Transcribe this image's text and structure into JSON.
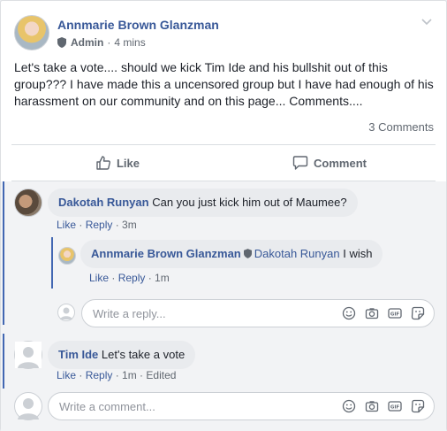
{
  "post": {
    "author": "Annmarie Brown Glanzman",
    "role": "Admin",
    "separator": "·",
    "time": "4 mins",
    "text": "Let's take a vote.... should we kick Tim Ide and his bullshit out of this group??? I have made this a uncensored group but I have had enough of his harassment on our community and on this page... Comments....",
    "comment_count": "3 Comments"
  },
  "actions": {
    "like": "Like",
    "comment": "Comment"
  },
  "comments": [
    {
      "author": "Dakotah Runyan",
      "text": "Can you just kick him out of Maumee?",
      "like": "Like",
      "reply": "Reply",
      "time": "3m",
      "replies": [
        {
          "author": "Annmarie Brown Glanzman",
          "mention": "Dakotah Runyan",
          "text": "I wish",
          "like": "Like",
          "reply": "Reply",
          "time": "1m"
        }
      ],
      "reply_placeholder": "Write a reply..."
    },
    {
      "author": "Tim Ide",
      "text": "Let's take a vote",
      "like": "Like",
      "reply": "Reply",
      "time": "1m",
      "edited": "Edited"
    }
  ],
  "composer": {
    "placeholder": "Write a comment..."
  },
  "icons": [
    "shield-icon",
    "chevron-down-icon",
    "like-thumb-icon",
    "comment-bubble-icon",
    "emoji-icon",
    "camera-icon",
    "gif-icon",
    "sticker-icon"
  ],
  "colors": {
    "link": "#385898",
    "accent": "#4267b2",
    "muted": "#606770",
    "bubble": "#e9ebee"
  }
}
